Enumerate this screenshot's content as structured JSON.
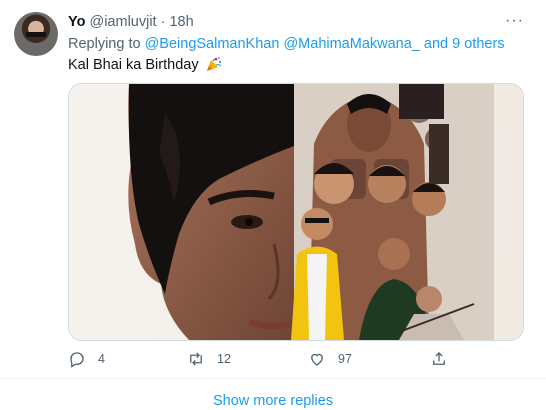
{
  "tweet": {
    "display_name": "Yo",
    "handle": "@iamluvjit",
    "separator": "·",
    "time": "18h",
    "replying_prefix": "Replying to",
    "mentions": [
      "@BeingSalmanKhan",
      "@MahimaMakwana_"
    ],
    "others": "and 9 others",
    "text": "Kal Bhai ka Birthday",
    "emoji": "party-popper-icon",
    "media_alt": "",
    "actions": {
      "reply_count": "4",
      "retweet_count": "12",
      "like_count": "97"
    }
  },
  "footer": {
    "show_more": "Show more replies"
  },
  "colors": {
    "accent": "#1d9bf0",
    "muted": "#536471",
    "text": "#0f1419",
    "border": "#cfd9de"
  }
}
